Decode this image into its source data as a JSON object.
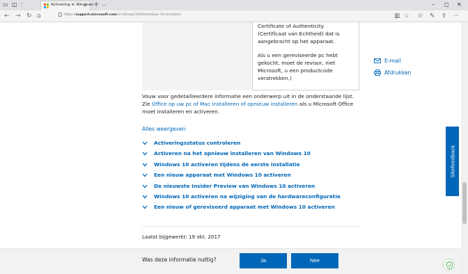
{
  "browser": {
    "tab_title": "Activering in Windows",
    "tab_close": "×",
    "new_tab": "+",
    "tab_chevron": "⌵",
    "window_controls": {
      "minimize": "–",
      "restore": "◻",
      "close": "✕"
    },
    "url_prefix": "https://",
    "url_host": "support.microsoft.com",
    "url_path": "/nl-nl/help/12440/windows-10-activation",
    "icons": {
      "back": "back-arrow-icon",
      "forward": "forward-arrow-icon",
      "refresh": "refresh-icon",
      "home": "home-icon",
      "reading_view": "reading-view-icon",
      "favorite": "star-icon",
      "favorites_hub": "favorites-icon",
      "pen": "pen-icon",
      "share": "share-icon",
      "more": "more-icon"
    },
    "more_glyph": "···"
  },
  "page": {
    "cert_text_1": "Certificate of Authenticity (Certificaat van Echtheid) dat is aangebracht op het apparaat.",
    "cert_text_2": "Als u een gereviseerde pc hebt gekocht, moet de revisor, niet Microsoft, u een productcode verstrekken.)",
    "side_links": {
      "email": "E-mail",
      "print": "Afdrukken"
    },
    "intro_before": "Vouw voor gedetailleerdere informatie een onderwerp uit in de onderstaande lijst. Zie ",
    "intro_link": "Office op uw pc of Mac installeren of opnieuw installeren",
    "intro_after": " als u Microsoft Office moet installeren en activeren.",
    "show_all": "Alles weergeven",
    "topics": [
      "Activeringsstatus controleren",
      "Activeren na het opnieuw installeren van Windows 10",
      "Windows 10 activeren tijdens de eerste installatie",
      "Een nieuw apparaat met Windows 10 activeren",
      "De nieuwste Insider Preview van Windows 10 activeren",
      "Windows 10 activeren na wijziging van de hardwareconfiguratie",
      "Een nieuw of gereviseerd apparaat met Windows 10 activeren"
    ],
    "last_updated": "Laatst bijgewerkt: 19 okt. 2017",
    "feedback_question": "Was deze informatie nuttig?",
    "yes_label": "Ja",
    "no_label": "Nee",
    "site_feedback": "Sitefeedback"
  },
  "colors": {
    "accent": "#0067b8",
    "ms_logo": [
      "#f25022",
      "#7fba00",
      "#00a4ef",
      "#ffb900"
    ]
  }
}
